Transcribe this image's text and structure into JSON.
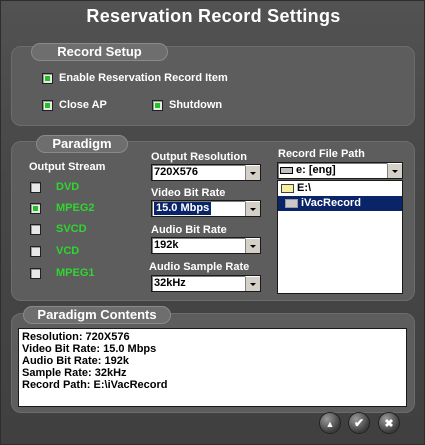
{
  "window": {
    "title": "Reservation Record Settings"
  },
  "record_setup": {
    "header": "Record Setup",
    "enable_item": {
      "label": "Enable Reservation Record Item",
      "checked": true
    },
    "close_ap": {
      "label": "Close AP",
      "checked": true
    },
    "shutdown": {
      "label": "Shutdown",
      "checked": true
    }
  },
  "paradigm": {
    "header": "Paradigm",
    "output_stream": {
      "label": "Output Stream",
      "options": [
        {
          "label": "DVD",
          "checked": false
        },
        {
          "label": "MPEG2",
          "checked": true
        },
        {
          "label": "SVCD",
          "checked": false
        },
        {
          "label": "VCD",
          "checked": false
        },
        {
          "label": "MPEG1",
          "checked": false
        }
      ]
    },
    "output_resolution": {
      "label": "Output Resolution",
      "value": "720X576"
    },
    "video_bit_rate": {
      "label": "Video Bit Rate",
      "value": "15.0 Mbps"
    },
    "audio_bit_rate": {
      "label": "Audio Bit Rate",
      "value": "192k"
    },
    "audio_sample_rate": {
      "label": "Audio Sample Rate",
      "value": "32kHz"
    },
    "record_file_path": {
      "label": "Record File Path",
      "drive": "e: [eng]",
      "tree": [
        {
          "label": "E:\\",
          "icon": "open-folder-icon",
          "selected": false
        },
        {
          "label": "iVacRecord",
          "icon": "folder-icon",
          "selected": true
        }
      ]
    }
  },
  "paradigm_contents": {
    "header": "Paradigm Contents",
    "lines": [
      "Resolution: 720X576",
      "Video Bit Rate: 15.0 Mbps",
      "Audio Bit Rate: 192k",
      "Sample Rate: 32kHz",
      "Record Path: E:\\iVacRecord"
    ]
  },
  "footer_buttons": {
    "up": {
      "icon": "up-arrow-icon",
      "glyph": "▲"
    },
    "ok": {
      "icon": "check-icon",
      "glyph": "✔"
    },
    "close": {
      "icon": "close-icon",
      "glyph": "✖"
    }
  }
}
